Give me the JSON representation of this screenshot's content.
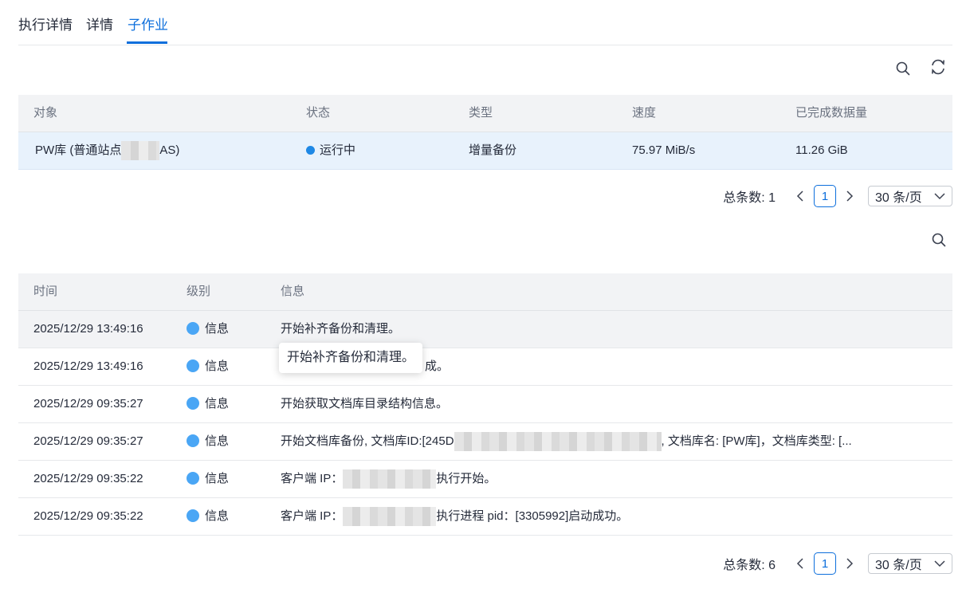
{
  "tabs": [
    {
      "label": "执行详情",
      "active": false
    },
    {
      "label": "详情",
      "active": false
    },
    {
      "label": "子作业",
      "active": true
    }
  ],
  "colors": {
    "accent": "#0d6fdc",
    "running": "#1e88e5",
    "info": "#4aa6f5"
  },
  "jobs_table": {
    "columns": [
      "对象",
      "状态",
      "类型",
      "速度",
      "已完成数据量"
    ],
    "rows": [
      {
        "object_prefix": "PW库 (普通站点",
        "object_suffix": "AS)",
        "status": "运行中",
        "type": "增量备份",
        "speed": "75.97 MiB/s",
        "done": "11.26 GiB"
      }
    ],
    "pagination": {
      "total_label": "总条数:",
      "total": "1",
      "page": "1",
      "page_size": "30 条/页"
    }
  },
  "log_table": {
    "columns": [
      "时间",
      "级别",
      "信息"
    ],
    "rows": [
      {
        "time": "2025/12/29 13:49:16",
        "level": "信息",
        "message": "开始补齐备份和清理。"
      },
      {
        "time": "2025/12/29 13:49:16",
        "level": "信息",
        "message": "成。"
      },
      {
        "time": "2025/12/29 09:35:27",
        "level": "信息",
        "message": "开始获取文档库目录结构信息。"
      },
      {
        "time": "2025/12/29 09:35:27",
        "level": "信息",
        "message_prefix": "开始文档库备份, 文档库ID:[245D",
        "message_suffix": ", 文档库名: [PW库]，文档库类型: [..."
      },
      {
        "time": "2025/12/29 09:35:22",
        "level": "信息",
        "message_prefix": "客户端 IP：",
        "message_suffix": "执行开始。"
      },
      {
        "time": "2025/12/29 09:35:22",
        "level": "信息",
        "message_prefix": "客户端 IP：",
        "message_suffix": "执行进程 pid：[3305992]启动成功。"
      }
    ],
    "pagination": {
      "total_label": "总条数:",
      "total": "6",
      "page": "1",
      "page_size": "30 条/页"
    }
  },
  "tooltip": {
    "text": "开始补齐备份和清理。"
  },
  "icons": {
    "search": "search-icon",
    "refresh": "refresh-icon",
    "chevron_left": "chevron-left-icon",
    "chevron_right": "chevron-right-icon",
    "chevron_down": "chevron-down-icon"
  }
}
